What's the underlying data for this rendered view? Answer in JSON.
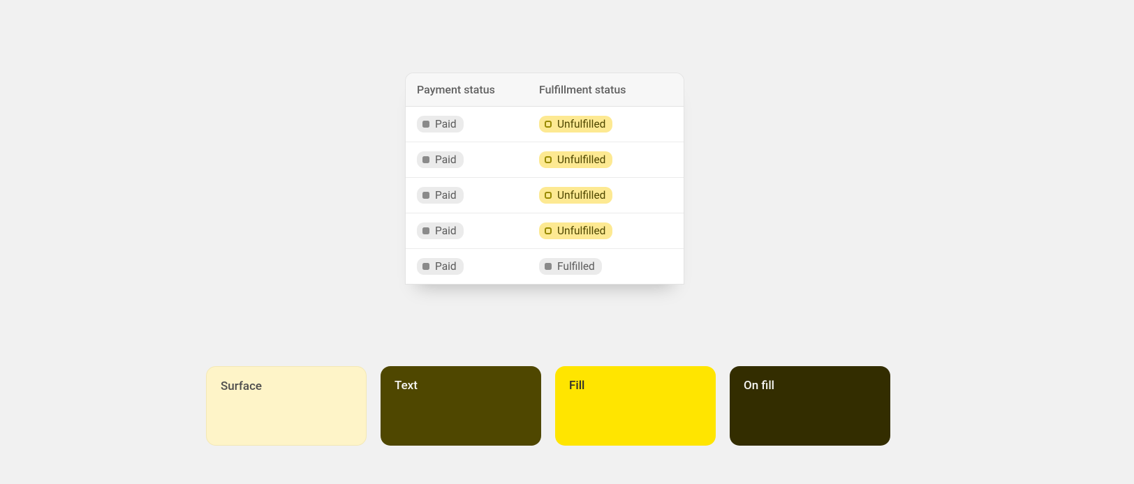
{
  "table": {
    "headers": {
      "payment": "Payment status",
      "fulfillment": "Fulfillment status"
    },
    "rows": [
      {
        "payment": "Paid",
        "fulfillment": "Unfulfilled",
        "fulfillment_variant": "yellow"
      },
      {
        "payment": "Paid",
        "fulfillment": "Unfulfilled",
        "fulfillment_variant": "yellow"
      },
      {
        "payment": "Paid",
        "fulfillment": "Unfulfilled",
        "fulfillment_variant": "yellow"
      },
      {
        "payment": "Paid",
        "fulfillment": "Unfulfilled",
        "fulfillment_variant": "yellow"
      },
      {
        "payment": "Paid",
        "fulfillment": "Fulfilled",
        "fulfillment_variant": "gray"
      }
    ]
  },
  "swatches": [
    {
      "label": "Surface",
      "class": "sw-surface"
    },
    {
      "label": "Text",
      "class": "sw-text"
    },
    {
      "label": "Fill",
      "class": "sw-fill"
    },
    {
      "label": "On fill",
      "class": "sw-onfill"
    }
  ],
  "colors": {
    "caution_surface": "#fef4c8",
    "caution_text": "#4f4700",
    "caution_fill": "#ffe500",
    "caution_on_fill": "#332d00"
  }
}
